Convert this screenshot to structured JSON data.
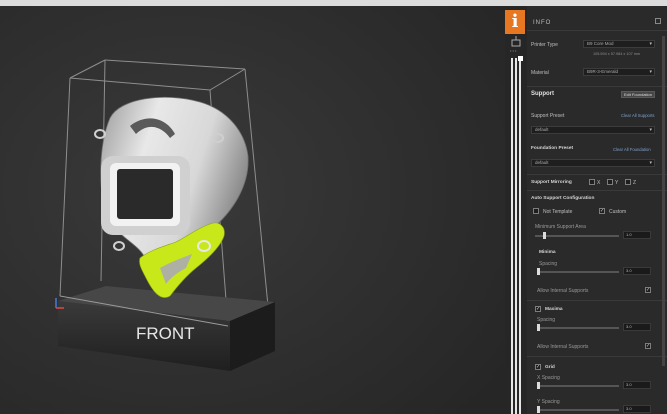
{
  "viewport": {
    "front_label": "FRONT"
  },
  "info_badge": {
    "icon": "info-icon",
    "glyph": "i",
    "color": "#e87722"
  },
  "slider_col": {
    "top_icon": "layers-icon",
    "dots": "• • •"
  },
  "panel": {
    "title": "INFO",
    "printer_type": {
      "label": "Printer Type",
      "value": "B9 Core Mod",
      "dims": "105.594 x 57.984 x 107 mm"
    },
    "material": {
      "label": "Material",
      "value": "B9R-3-Emerald"
    },
    "support": {
      "heading": "Support",
      "button": "Edit Foundation",
      "preset_label": "Support Preset",
      "preset_link": "Clear All Supports",
      "preset_value": "default",
      "foundation_label": "Foundation Preset",
      "foundation_link": "Clear All Foundation",
      "foundation_value": "default",
      "mirroring_label": "Support Mirroring",
      "mirroring_axes": [
        "X",
        "Y",
        "Z"
      ]
    },
    "auto": {
      "heading": "Auto Support Configuration",
      "option_template": "Not Template",
      "option_custom": "Custom",
      "min_area_label": "Minimum Support Area",
      "min_area_value": "1.0",
      "minima": {
        "heading": "Minima",
        "spacing_label": "Spacing",
        "spacing_value": "3.0",
        "internal_label": "Allow Internal Supports"
      },
      "maxima": {
        "heading": "Maxima",
        "spacing_label": "Spacing",
        "spacing_value": "3.0",
        "internal_label": "Allow Internal Supports"
      },
      "grid": {
        "heading": "Grid",
        "x_label": "X Spacing",
        "x_value": "3.0",
        "y_label": "Y Spacing",
        "y_value": "3.0"
      }
    }
  }
}
